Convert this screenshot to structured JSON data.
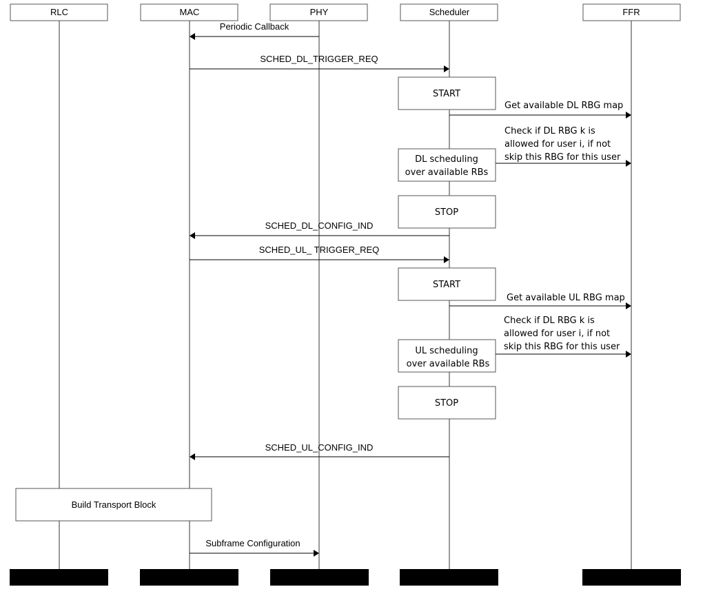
{
  "diagram": {
    "type": "sequence-diagram",
    "participants": [
      {
        "id": "rlc",
        "label": "RLC"
      },
      {
        "id": "mac",
        "label": "MAC"
      },
      {
        "id": "phy",
        "label": "PHY"
      },
      {
        "id": "scheduler",
        "label": "Scheduler"
      },
      {
        "id": "ffr",
        "label": "FFR"
      }
    ],
    "messages": [
      {
        "id": "periodic-callback",
        "from": "phy",
        "to": "mac",
        "label": "Periodic Callback"
      },
      {
        "id": "sched-dl-trigger-req",
        "from": "mac",
        "to": "scheduler",
        "label": "SCHED_DL_TRIGGER_REQ"
      },
      {
        "id": "get-dl-rbg-map",
        "from": "scheduler",
        "to": "ffr",
        "label": "Get available DL RBG map"
      },
      {
        "id": "check-dl-rbg",
        "from": "scheduler",
        "to": "ffr",
        "label_lines": [
          "Check if DL RBG k is",
          "allowed for user i, if not",
          "skip this RBG for this user"
        ]
      },
      {
        "id": "sched-dl-config-ind",
        "from": "scheduler",
        "to": "mac",
        "label": "SCHED_DL_CONFIG_IND"
      },
      {
        "id": "sched-ul-trigger-req",
        "from": "mac",
        "to": "scheduler",
        "label": "SCHED_UL_ TRIGGER_REQ"
      },
      {
        "id": "get-ul-rbg-map",
        "from": "scheduler",
        "to": "ffr",
        "label": "Get available UL RBG map"
      },
      {
        "id": "check-ul-rbg",
        "from": "scheduler",
        "to": "ffr",
        "label_lines": [
          "Check if DL RBG k is",
          "allowed for user i, if not",
          "skip this RBG for this user"
        ]
      },
      {
        "id": "sched-ul-config-ind",
        "from": "scheduler",
        "to": "mac",
        "label": "SCHED_UL_CONFIG_IND"
      },
      {
        "id": "subframe-configuration",
        "from": "mac",
        "to": "phy",
        "label": "Subframe Configuration"
      }
    ],
    "activities": [
      {
        "id": "dl-start",
        "participant": "scheduler",
        "label_lines": [
          "START"
        ]
      },
      {
        "id": "dl-scheduling",
        "participant": "scheduler",
        "label_lines": [
          "DL scheduling",
          "over available RBs"
        ]
      },
      {
        "id": "dl-stop",
        "participant": "scheduler",
        "label_lines": [
          "STOP"
        ]
      },
      {
        "id": "ul-start",
        "participant": "scheduler",
        "label_lines": [
          "START"
        ]
      },
      {
        "id": "ul-scheduling",
        "participant": "scheduler",
        "label_lines": [
          "UL scheduling",
          "over available RBs"
        ]
      },
      {
        "id": "ul-stop",
        "participant": "scheduler",
        "label_lines": [
          "STOP"
        ]
      },
      {
        "id": "build-transport-block",
        "participant": "rlc-mac",
        "label_lines": [
          "Build Transport Block"
        ]
      }
    ]
  }
}
